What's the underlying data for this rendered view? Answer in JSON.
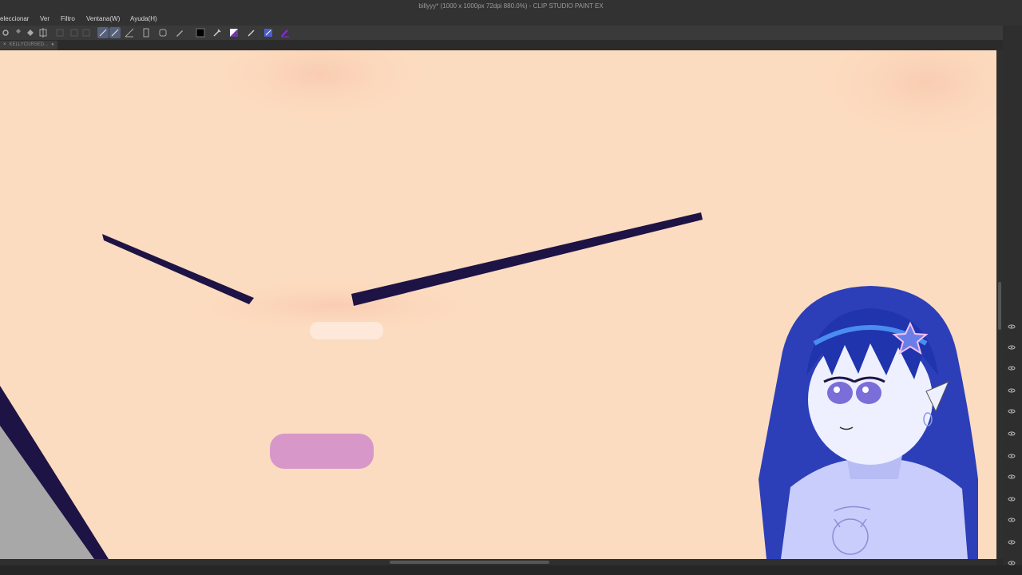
{
  "window": {
    "title": "billyyy* (1000 x 1000px 72dpi 880.0%) - CLIP STUDIO PAINT EX"
  },
  "menu": {
    "items": [
      "eleccionar",
      "Ver",
      "Filtro",
      "Ventana(W)",
      "Ayuda(H)"
    ]
  },
  "toolbar": {
    "icons": [
      "settings-icon",
      "undo-icon",
      "redo-icon",
      "transform-icon",
      "selection-icon",
      "pen-tool-icon",
      "brush-tool-icon",
      "ruler-icon",
      "layer-icon",
      "reference-icon",
      "pen-icon",
      "color-swatch-icon",
      "eyedropper-icon",
      "invert-icon",
      "pencil-icon",
      "fill-icon",
      "brush-purple-icon"
    ]
  },
  "tab": {
    "label": "KELLYCURSED..."
  },
  "colors": {
    "canvas_skin": "#fcdcc0",
    "lineart": "#1e1345",
    "mouth": "#d797c8",
    "accent": "#8a2be2"
  }
}
